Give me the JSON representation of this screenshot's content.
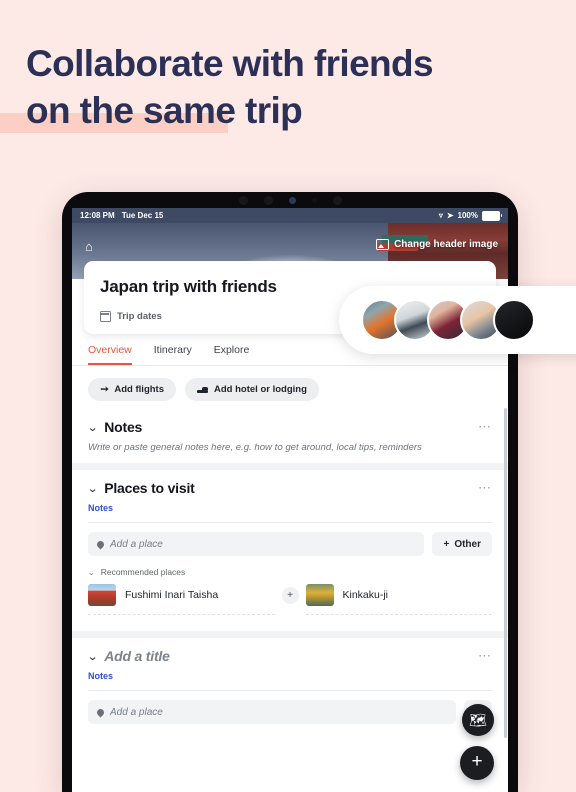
{
  "marketing": {
    "line1": "Collaborate with friends",
    "line2": "on the same trip",
    "text_color": "#2c3057",
    "highlight_color": "#fbcfc4",
    "background_color": "#fdeae6"
  },
  "status_bar": {
    "time": "12:08 PM",
    "date": "Tue Dec 15",
    "wifi_icon": "wifi-icon",
    "location_icon": "location-arrow-icon",
    "battery_percent": "100%",
    "battery_icon": "battery-full-icon"
  },
  "hero": {
    "home_icon": "home-icon",
    "change_header_label": "Change header image",
    "change_header_icon": "image-icon"
  },
  "trip": {
    "title": "Japan trip with friends",
    "dates_label": "Trip dates",
    "calendar_icon": "calendar-icon"
  },
  "tabs": [
    {
      "label": "Overview",
      "active": true
    },
    {
      "label": "Itinerary",
      "active": false
    },
    {
      "label": "Explore",
      "active": false
    }
  ],
  "tab_accent_color": "#e8553c",
  "quick_actions": [
    {
      "label": "Add flights",
      "icon": "airplane-icon"
    },
    {
      "label": "Add hotel or lodging",
      "icon": "bed-icon"
    }
  ],
  "sections": {
    "notes": {
      "title": "Notes",
      "placeholder": "Write or paste general notes here, e.g. how to get around, local tips, reminders",
      "chevron_icon": "chevron-down-icon",
      "menu_icon": "more-options-icon"
    },
    "places_to_visit": {
      "title": "Places to visit",
      "notes_link": "Notes",
      "notes_link_color": "#2f4fd8",
      "chevron_icon": "chevron-down-icon",
      "menu_icon": "more-options-icon",
      "add_place_placeholder": "Add a place",
      "pin_icon": "map-pin-icon",
      "other_button": "Other",
      "other_icon": "plus-icon",
      "recommended_label": "Recommended places",
      "recommended": [
        {
          "name": "Fushimi Inari Taisha",
          "thumb": "torii-gate-thumb"
        },
        {
          "name": "Kinkaku-ji",
          "thumb": "golden-pavilion-thumb"
        }
      ],
      "recommended_add_icon": "plus-icon"
    },
    "untitled": {
      "title": "Add a title",
      "notes_link": "Notes",
      "chevron_icon": "chevron-down-icon",
      "menu_icon": "more-options-icon",
      "add_place_placeholder": "Add a place",
      "pin_icon": "map-pin-icon",
      "other_icon": "plus-icon"
    }
  },
  "fabs": [
    {
      "name": "map-fab",
      "icon": "map-icon",
      "glyph": "🗺"
    },
    {
      "name": "add-fab",
      "icon": "plus-icon",
      "glyph": "+"
    }
  ],
  "collaborators": {
    "avatar_count": 5,
    "avatars": [
      "avatar-1",
      "avatar-2",
      "avatar-3",
      "avatar-4",
      "avatar-5"
    ]
  }
}
